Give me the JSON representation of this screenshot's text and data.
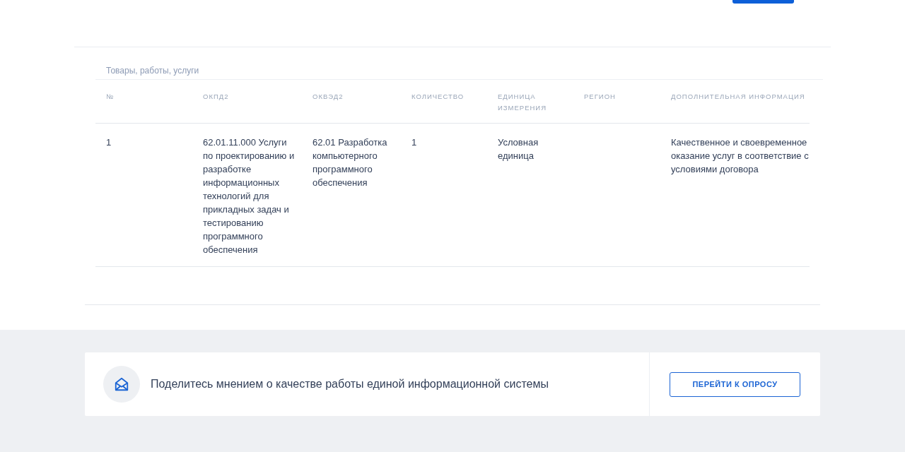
{
  "section_title": "Товары, работы, услуги",
  "table": {
    "columns": [
      "№",
      "ОКПД2",
      "ОКВЭД2",
      "КОЛИЧЕСТВО",
      "ЕДИНИЦА ИЗМЕРЕНИЯ",
      "РЕГИОН",
      "ДОПОЛНИТЕЛЬНАЯ ИНФОРМАЦИЯ"
    ],
    "rows": [
      [
        "1",
        "62.01.11.000 Услуги по проектированию и разработке информационных технологий для прикладных задач и тестированию программного обеспечения",
        "62.01 Разработка компьютерного программного обеспечения",
        "1",
        "Условная единица",
        "",
        "Качественное и своевременное оказание услуг в соответствие с условиями договора"
      ]
    ]
  },
  "survey": {
    "text": "Поделитесь мнением о качестве работы единой информационной системы",
    "button": "ПЕРЕЙТИ К ОПРОСУ"
  }
}
